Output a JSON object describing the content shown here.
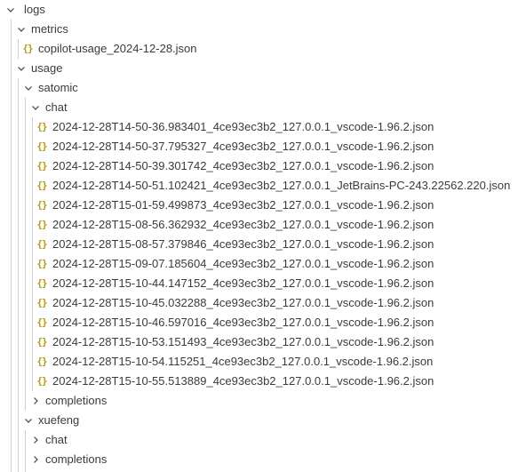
{
  "tree": {
    "logs": {
      "label": "logs",
      "metrics": {
        "label": "metrics",
        "files": [
          "copilot-usage_2024-12-28.json"
        ]
      },
      "usage": {
        "label": "usage",
        "satomic": {
          "label": "satomic",
          "chat": {
            "label": "chat",
            "files": [
              "2024-12-28T14-50-36.983401_4ce93ec3b2_127.0.0.1_vscode-1.96.2.json",
              "2024-12-28T14-50-37.795327_4ce93ec3b2_127.0.0.1_vscode-1.96.2.json",
              "2024-12-28T14-50-39.301742_4ce93ec3b2_127.0.0.1_vscode-1.96.2.json",
              "2024-12-28T14-50-51.102421_4ce93ec3b2_127.0.0.1_JetBrains-PC-243.22562.220.json",
              "2024-12-28T15-01-59.499873_4ce93ec3b2_127.0.0.1_vscode-1.96.2.json",
              "2024-12-28T15-08-56.362932_4ce93ec3b2_127.0.0.1_vscode-1.96.2.json",
              "2024-12-28T15-08-57.379846_4ce93ec3b2_127.0.0.1_vscode-1.96.2.json",
              "2024-12-28T15-09-07.185604_4ce93ec3b2_127.0.0.1_vscode-1.96.2.json",
              "2024-12-28T15-10-44.147152_4ce93ec3b2_127.0.0.1_vscode-1.96.2.json",
              "2024-12-28T15-10-45.032288_4ce93ec3b2_127.0.0.1_vscode-1.96.2.json",
              "2024-12-28T15-10-46.597016_4ce93ec3b2_127.0.0.1_vscode-1.96.2.json",
              "2024-12-28T15-10-53.151493_4ce93ec3b2_127.0.0.1_vscode-1.96.2.json",
              "2024-12-28T15-10-54.115251_4ce93ec3b2_127.0.0.1_vscode-1.96.2.json",
              "2024-12-28T15-10-55.513889_4ce93ec3b2_127.0.0.1_vscode-1.96.2.json"
            ]
          },
          "completions": {
            "label": "completions"
          }
        },
        "xuefeng": {
          "label": "xuefeng",
          "chat": {
            "label": "chat"
          },
          "completions": {
            "label": "completions"
          }
        }
      }
    },
    "json_icon_glyph": "{}"
  },
  "colors": {
    "json_icon": "#b39b0f",
    "text": "#3b3b3b",
    "indent_guide": "#d0d0d0"
  },
  "icons": {
    "expanded": "chevron-down-icon",
    "collapsed": "chevron-right-icon",
    "file": "json-file-icon"
  }
}
